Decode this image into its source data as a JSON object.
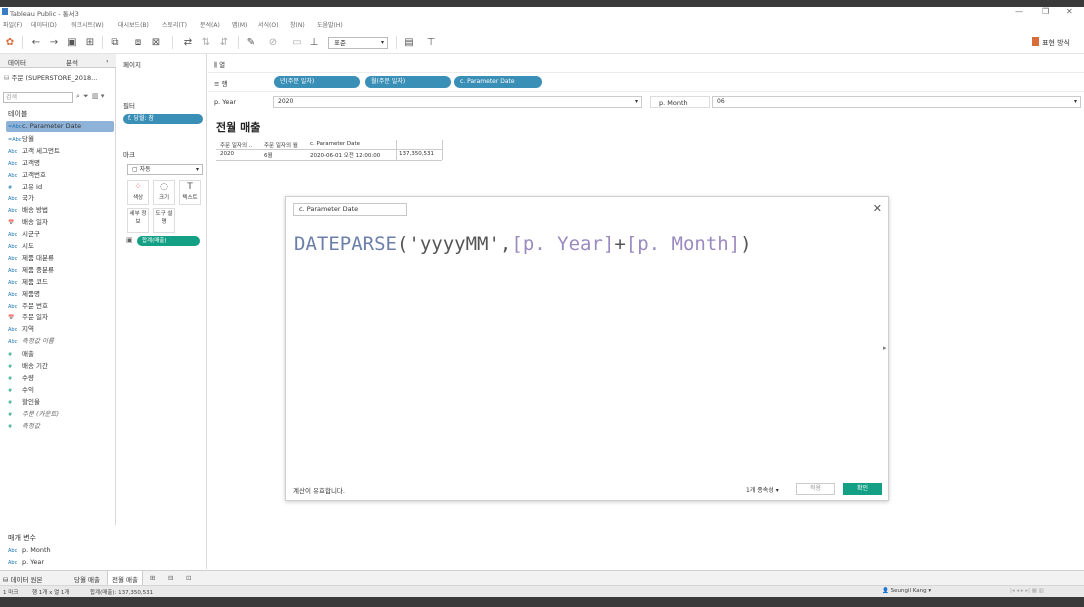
{
  "window": {
    "title": "Tableau Public - 통서3",
    "controls": [
      "—",
      "❐",
      "✕"
    ]
  },
  "menu": [
    "파일(F)",
    "데이터(D)",
    "워크시트(W)",
    "대시보드(B)",
    "스토리(T)",
    "분석(A)",
    "맵(M)",
    "서식(O)",
    "창(N)",
    "도움말(H)"
  ],
  "toolbar": {
    "fit_select": "표준",
    "show_me": "표현 방식"
  },
  "data_pane": {
    "tab_data": "데이터",
    "tab_analysis": "분석",
    "datasource": "주문 (SUPERSTORE_2018...",
    "search_placeholder": "검색",
    "tables_header": "테이블",
    "dimensions": [
      {
        "type": "=Abc",
        "name": "c. Parameter Date"
      },
      {
        "type": "=Abc",
        "name": "당월"
      },
      {
        "type": "Abc",
        "name": "고객 세그먼트"
      },
      {
        "type": "Abc",
        "name": "고객명"
      },
      {
        "type": "Abc",
        "name": "고객번호"
      },
      {
        "type": "#",
        "name": "고유 Id"
      },
      {
        "type": "Abc",
        "name": "국가"
      },
      {
        "type": "Abc",
        "name": "배송 방법"
      },
      {
        "type": "📅",
        "name": "배송 일자"
      },
      {
        "type": "Abc",
        "name": "시군구"
      },
      {
        "type": "Abc",
        "name": "시도"
      },
      {
        "type": "Abc",
        "name": "제품 대분류"
      },
      {
        "type": "Abc",
        "name": "제품 중분류"
      },
      {
        "type": "Abc",
        "name": "제품 코드"
      },
      {
        "type": "Abc",
        "name": "제품명"
      },
      {
        "type": "Abc",
        "name": "주문 번호"
      },
      {
        "type": "📅",
        "name": "주문 일자"
      },
      {
        "type": "Abc",
        "name": "지역"
      },
      {
        "type": "Abc",
        "name": "측정값 이름"
      }
    ],
    "measures": [
      {
        "type": "#",
        "name": "매출"
      },
      {
        "type": "#",
        "name": "배송 기간"
      },
      {
        "type": "#",
        "name": "수량"
      },
      {
        "type": "#",
        "name": "수익"
      },
      {
        "type": "#",
        "name": "할인율"
      },
      {
        "type": "#",
        "name": "주문 (카운트)"
      },
      {
        "type": "#",
        "name": "측정값"
      }
    ],
    "params_header": "매개 변수",
    "params": [
      {
        "type": "Abc",
        "name": "p. Month"
      },
      {
        "type": "Abc",
        "name": "p. Year"
      }
    ]
  },
  "shelves": {
    "pages": "페이지",
    "filters": "필터",
    "filter_pill": "f. 당월: 참",
    "marks": "마크",
    "mark_type": "자동",
    "mark_buttons": [
      "색상",
      "크기",
      "텍스트",
      "세부 정보",
      "도구 설명"
    ],
    "sum_pill": "합계(매출)",
    "columns_label": "열",
    "rows_label": "행",
    "row_pills": [
      "년(주문 일자)",
      "월(주문 일자)",
      "c. Parameter Date"
    ]
  },
  "param_controls": {
    "year_label": "p. Year",
    "year_value": "2020",
    "month_label": "p. Month",
    "month_value": "06"
  },
  "view": {
    "sheet_title": "전월 매출",
    "headers": [
      "주문 일자의 ..",
      "주문 일자의 월",
      "c. Parameter Date"
    ],
    "row": [
      "2020",
      "6월",
      "2020-06-01 오전 12:00:00",
      "137,350,531"
    ]
  },
  "dialog": {
    "calc_name": "c. Parameter Date",
    "formula": {
      "func": "DATEPARSE",
      "open": "(",
      "str": "'yyyyMM'",
      "comma": ",",
      "p1": "[p. Year]",
      "plus": "+",
      "p2": "[p. Month]",
      "close": ")"
    },
    "status": "계산이 유효합니다.",
    "dependencies": "1개 종속성 ▾",
    "apply": "적용",
    "ok": "확인"
  },
  "sheet_tabs": {
    "datasource": "데이터 원본",
    "tabs": [
      "당월 매출",
      "전월 매출"
    ]
  },
  "status_bar": {
    "marks": "1 마크",
    "rows_cols": "행 1개 x 열 1개",
    "sum": "합계(매출): 137,350,531",
    "user": "Seungil Kang"
  },
  "colors": {
    "pill_blue": "#3a8fb7",
    "measure_green": "#14a085",
    "formula_func": "#6b7fa8",
    "formula_param": "#9b8ac0"
  }
}
